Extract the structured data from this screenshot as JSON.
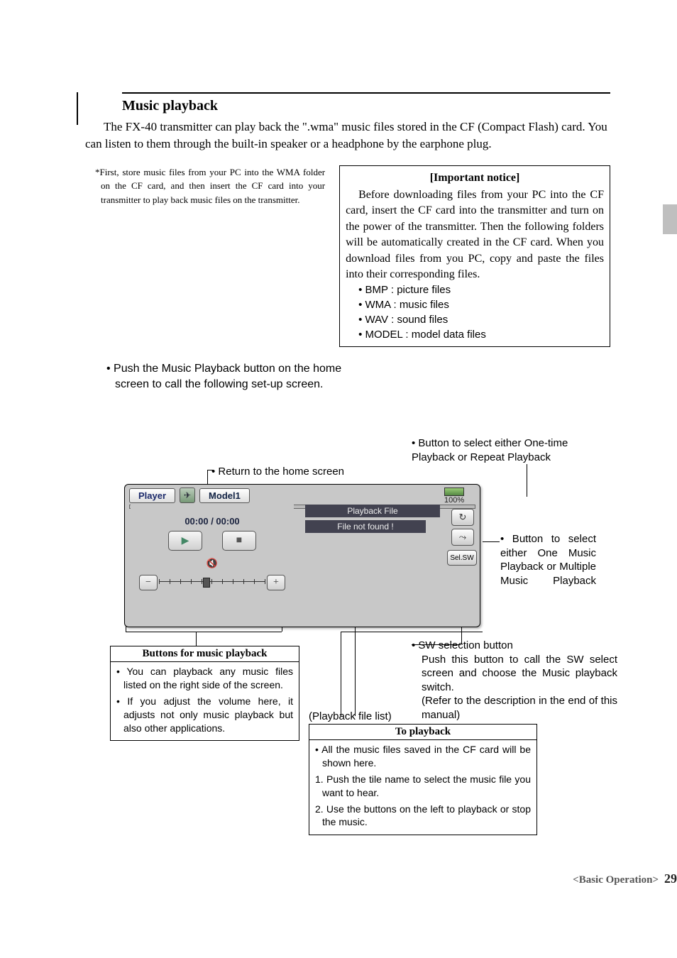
{
  "header": {
    "title": "Music playback",
    "intro": "The FX-40 transmitter can play back the \".wma\" music files stored in the CF (Compact Flash) card. You can listen to them through the built-in speaker or a headphone by the earphone plug."
  },
  "left_note": "*First, store music files from your PC into the WMA folder on the CF card, and then insert the CF card into your transmitter to play back music files on the transmitter.",
  "notice": {
    "title": "[Important notice]",
    "body": "Before downloading files from your PC into the CF card, insert the CF card into the transmitter and turn on the power of the transmitter. Then the following folders will be automatically created in the CF card. When you download files from you PC, copy and paste the files into their corresponding files.",
    "items": [
      "• BMP : picture files",
      "• WMA : music files",
      "• WAV : sound files",
      "• MODEL : model data files"
    ]
  },
  "call_instr": "• Push the Music Playback button on the home screen to call the following set-up screen.",
  "callouts": {
    "return_home": "• Return to the home screen",
    "repeat": "• Button to select either One-time Playback or Repeat Playback",
    "multi": "• Button to select either One Music Playback or Multiple Music Playback",
    "sw_title": "• SW selection button",
    "sw_1": "Push this button to call the SW select screen and choose the Music playback switch.",
    "sw_2": "(Refer to the description in the end of this manual)",
    "playback_list": "(Playback file list)"
  },
  "player": {
    "label": "Player",
    "model": "Model1",
    "battery": "100%",
    "time": "00:00  /  00:00",
    "file_header": "Playback File",
    "file_not_found": "File not found !",
    "sel_sw": "Sel.SW"
  },
  "playback_box": {
    "title": "Buttons for music playback",
    "b1": "• You can playback any music files listed on the right side of the screen.",
    "b2": "• If you adjust the volume here, it adjusts not only music playback but also other applications."
  },
  "to_playback": {
    "title": "To playback",
    "t1": "• All the music files saved in the CF card will be shown here.",
    "t2": "1. Push the tile name to select the music file you want to hear.",
    "t3": "2. Use the buttons on the left to playback or stop the music."
  },
  "footer": {
    "section": "<Basic Operation>",
    "page": "29"
  }
}
